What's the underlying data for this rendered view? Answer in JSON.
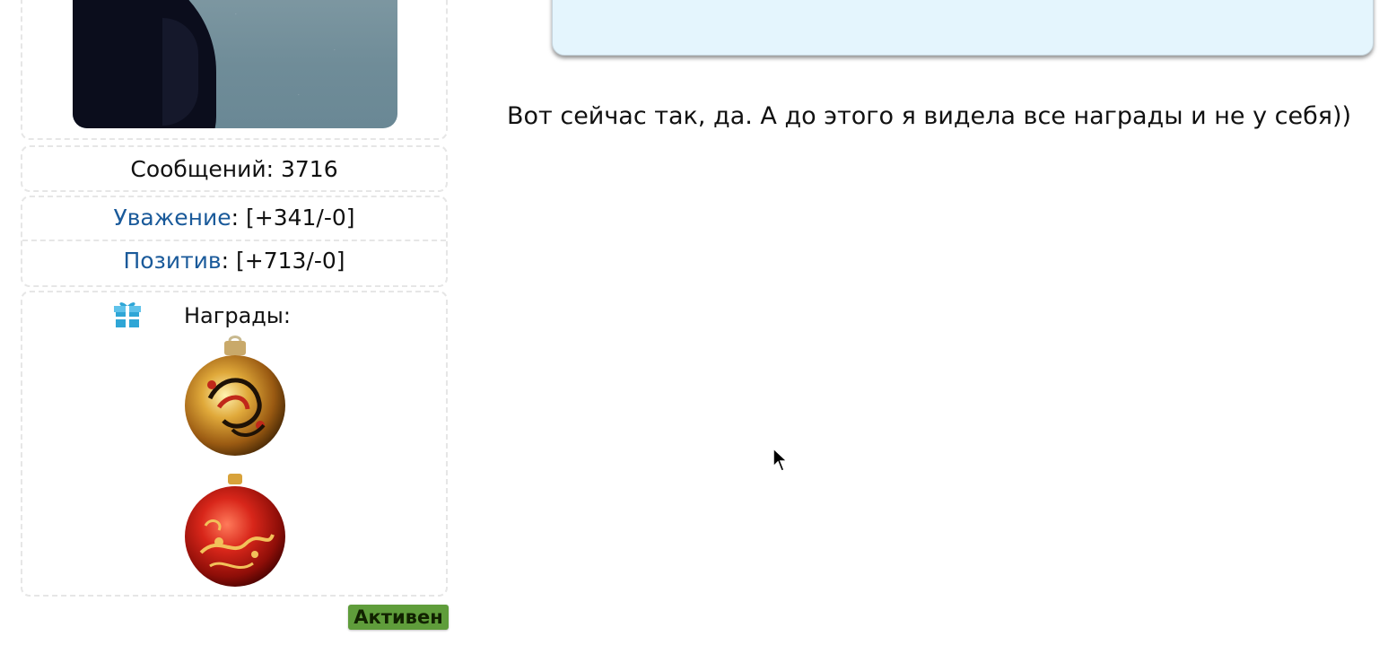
{
  "user_panel": {
    "posts": "Сообщений: 3716",
    "respect": {
      "label": "Уважение",
      "value": ": [+341/-0]"
    },
    "positive": {
      "label": "Позитив",
      "value": ": [+713/-0]"
    },
    "awards": {
      "title": "Награды:",
      "icon": "gift-icon",
      "items": [
        "gold-khokhloma-ornament",
        "red-khokhloma-ornament"
      ]
    },
    "status": "Активен"
  },
  "post": {
    "message": "Вот сейчас так, да. А до этого я видела все награды и не у себя))"
  },
  "colors": {
    "link": "#1a5a9a",
    "quote_bg": "#e4f5fd",
    "status_bg": "#5f9d3b",
    "panel_border": "#e6e6e6"
  }
}
